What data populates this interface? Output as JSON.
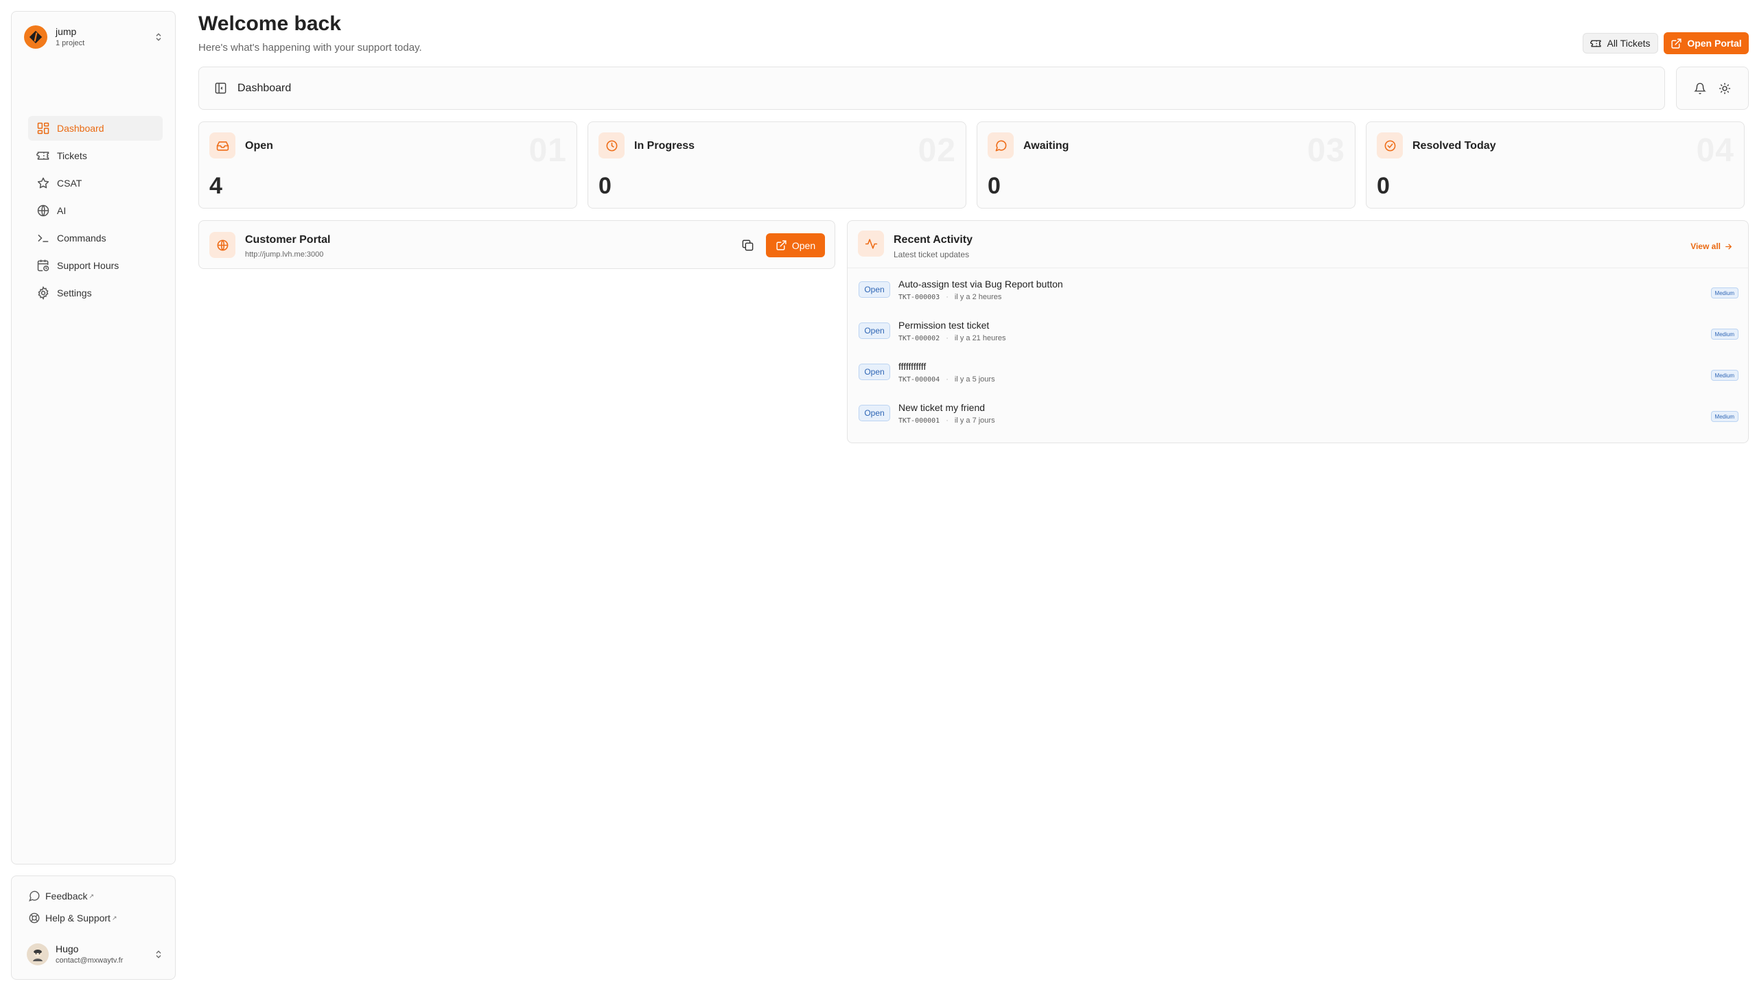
{
  "workspace": {
    "name": "jump",
    "subtitle": "1 project"
  },
  "sidebar": {
    "items": [
      {
        "label": "Dashboard",
        "icon": "dashboard-icon",
        "active": true
      },
      {
        "label": "Tickets",
        "icon": "ticket-icon",
        "active": false
      },
      {
        "label": "CSAT",
        "icon": "star-icon",
        "active": false
      },
      {
        "label": "AI",
        "icon": "globe-icon",
        "active": false
      },
      {
        "label": "Commands",
        "icon": "terminal-icon",
        "active": false
      },
      {
        "label": "Support Hours",
        "icon": "calendar-clock-icon",
        "active": false
      },
      {
        "label": "Settings",
        "icon": "gear-icon",
        "active": false
      }
    ],
    "footer": {
      "feedback": "Feedback",
      "help": "Help & Support",
      "user": {
        "name": "Hugo",
        "email": "contact@mxwaytv.fr"
      }
    }
  },
  "header": {
    "title": "Welcome back",
    "subtitle": "Here's what's happening with your support today.",
    "all_tickets_label": "All Tickets",
    "open_portal_label": "Open Portal"
  },
  "breadcrumb": {
    "current": "Dashboard"
  },
  "stats": [
    {
      "label": "Open",
      "value": "4",
      "index": "01",
      "icon": "inbox-icon"
    },
    {
      "label": "In Progress",
      "value": "0",
      "index": "02",
      "icon": "clock-icon"
    },
    {
      "label": "Awaiting",
      "value": "0",
      "index": "03",
      "icon": "message-circle-icon"
    },
    {
      "label": "Resolved Today",
      "value": "0",
      "index": "04",
      "icon": "check-circle-icon"
    }
  ],
  "portal": {
    "title": "Customer Portal",
    "url": "http://jump.lvh.me:3000",
    "open_label": "Open"
  },
  "activity": {
    "title": "Recent Activity",
    "subtitle": "Latest ticket updates",
    "view_all": "View all",
    "tickets": [
      {
        "status": "Open",
        "title": "Auto-assign test via Bug Report button",
        "id": "TKT-000003",
        "time": "il y a 2 heures",
        "priority": "Medium"
      },
      {
        "status": "Open",
        "title": "Permission test ticket",
        "id": "TKT-000002",
        "time": "il y a 21 heures",
        "priority": "Medium"
      },
      {
        "status": "Open",
        "title": "fffffffffff",
        "id": "TKT-000004",
        "time": "il y a 5 jours",
        "priority": "Medium"
      },
      {
        "status": "Open",
        "title": "New ticket my friend",
        "id": "TKT-000001",
        "time": "il y a 7 jours",
        "priority": "Medium"
      }
    ]
  },
  "colors": {
    "accent": "#f36a0f",
    "status_blue": "#2f66b5"
  }
}
